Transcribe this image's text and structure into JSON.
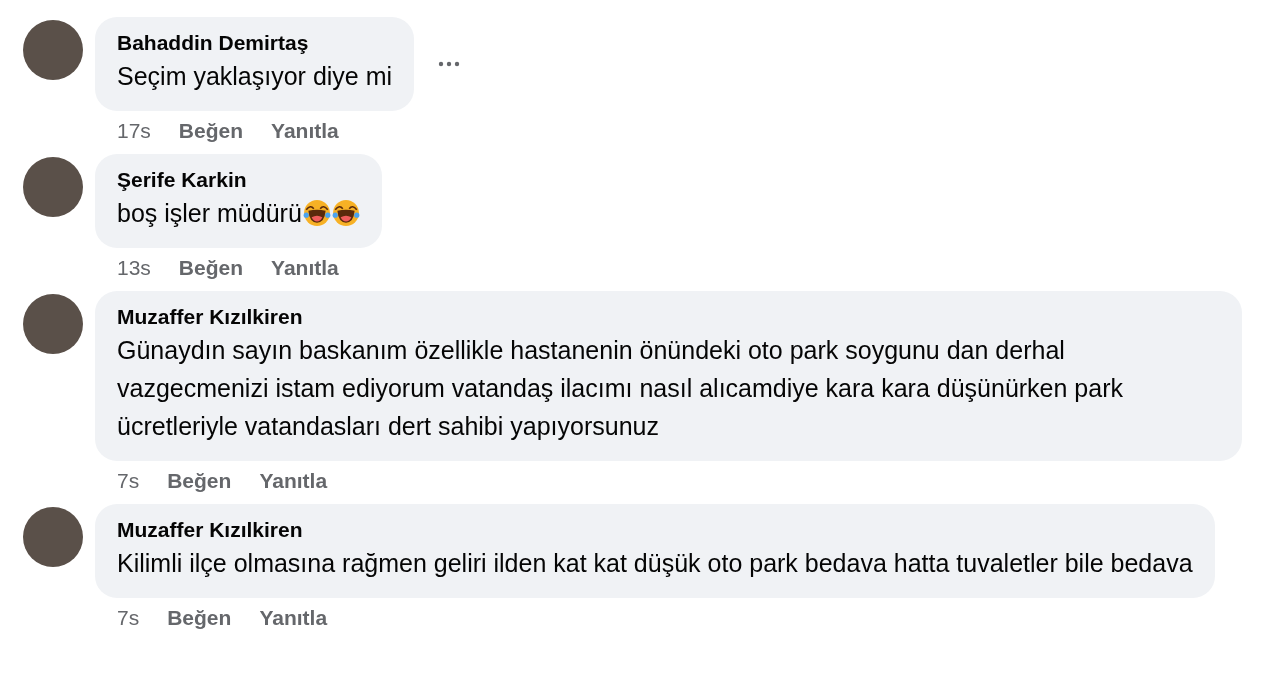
{
  "comments": [
    {
      "author": "Bahaddin Demirtaş",
      "text": "Seçim yaklaşıyor diye mi",
      "menu_visible": true,
      "time": "17s",
      "actions": [
        "Beğen",
        "Yanıtla"
      ]
    },
    {
      "author": "Şerife Karkin",
      "text": "boş işler müdürü",
      "emojis": [
        {
          "kind": "laughing-tears"
        },
        {
          "kind": "laughing-tears"
        }
      ],
      "menu_visible": false,
      "time": "13s",
      "actions": [
        "Beğen",
        "Yanıtla"
      ]
    },
    {
      "author": "Muzaffer Kızılkiren",
      "text": "Günaydın sayın baskanım özellikle hastanenin önündeki oto park soygunu dan derhal vazgecmenizi istam ediyorum vatandaş ilacımı nasıl alıcamdiye kara kara düşünürken park ücretleriyle vatandasları dert sahibi yapıyorsunuz",
      "menu_visible": false,
      "time": "7s",
      "actions": [
        "Beğen",
        "Yanıtla"
      ]
    },
    {
      "author": "Muzaffer Kızılkiren",
      "text": "Kilimli ilçe olmasına rağmen geliri ilden kat kat düşük oto park bedava hatta tuvaletler bile bedava",
      "menu_visible": false,
      "time": "7s",
      "actions": [
        "Beğen",
        "Yanıtla"
      ]
    }
  ]
}
